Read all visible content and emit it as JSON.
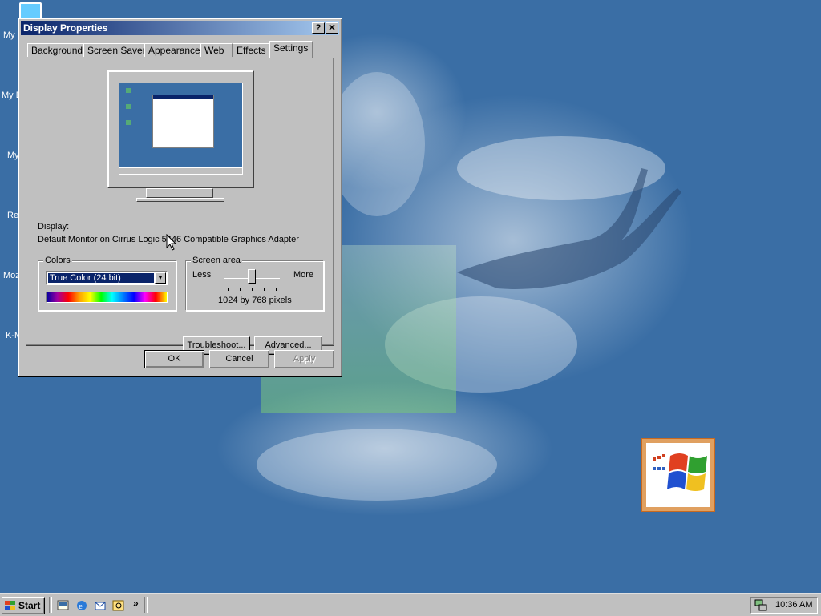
{
  "desktop": {
    "icons": [
      {
        "label": "My"
      },
      {
        "label": "My D"
      },
      {
        "label": "My"
      },
      {
        "label": "Re"
      },
      {
        "label": "Moz"
      },
      {
        "label": "K-M"
      }
    ]
  },
  "window": {
    "title": "Display Properties",
    "help_glyph": "?",
    "close_glyph": "✕",
    "tabs": [
      {
        "label": "Background"
      },
      {
        "label": "Screen Saver"
      },
      {
        "label": "Appearance"
      },
      {
        "label": "Web"
      },
      {
        "label": "Effects"
      },
      {
        "label": "Settings",
        "active": true
      }
    ],
    "settings": {
      "display_label": "Display:",
      "display_value": "Default Monitor on Cirrus Logic 5446 Compatible Graphics Adapter",
      "colors": {
        "legend": "Colors",
        "selected": "True Color (24 bit)"
      },
      "screen_area": {
        "legend": "Screen area",
        "less": "Less",
        "more": "More",
        "resolution": "1024 by 768 pixels",
        "slider_position": 0.5
      },
      "troubleshoot_button": "Troubleshoot...",
      "advanced_button": "Advanced..."
    },
    "ok_button": "OK",
    "cancel_button": "Cancel",
    "apply_button": "Apply"
  },
  "taskbar": {
    "start_label": "Start",
    "chevron": "»",
    "clock": "10:36 AM"
  },
  "colors": {
    "desktop": "#3a6ea5",
    "titlebar_start": "#0a246a",
    "titlebar_end": "#a6caf0",
    "face": "#c0c0c0"
  }
}
